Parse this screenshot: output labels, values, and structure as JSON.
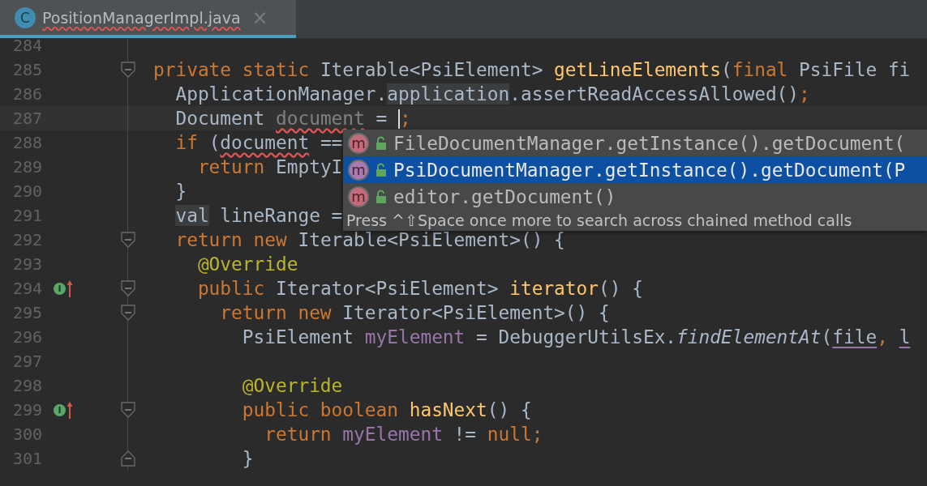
{
  "tab": {
    "icon_letter": "C",
    "title": "PositionManagerImpl.java",
    "close": "×",
    "selected": true
  },
  "lines": [
    {
      "number": "284"
    },
    {
      "number": "285",
      "fold": {
        "kind": "start"
      },
      "tokens": [
        {
          "text": "private static ",
          "kind": "keyword"
        },
        {
          "text": "Iterable<PsiElement> ",
          "kind": "plain"
        },
        {
          "text": "getLineElements",
          "kind": "declaration"
        },
        {
          "text": "(",
          "kind": "plain"
        },
        {
          "text": "final ",
          "kind": "keyword"
        },
        {
          "text": "PsiFile fi",
          "kind": "plain"
        }
      ]
    },
    {
      "number": "286",
      "tokens": [
        {
          "text": "  ApplicationManager.",
          "kind": "plain"
        },
        {
          "text": "application",
          "kind": "highlighted"
        },
        {
          "text": ".assertReadAccessAllowed()",
          "kind": "plain"
        },
        {
          "text": ";",
          "kind": "keyword"
        }
      ]
    },
    {
      "number": "287",
      "current": true,
      "tokens": [
        {
          "text": "  Document ",
          "kind": "plain"
        },
        {
          "text": "document",
          "kind": "unused"
        },
        {
          "text": " = ",
          "kind": "plain"
        },
        {
          "kind": "caret"
        },
        {
          "text": ";",
          "kind": "keyword"
        }
      ]
    },
    {
      "number": "288",
      "tokens": [
        {
          "text": "  if ",
          "kind": "keyword"
        },
        {
          "text": "(",
          "kind": "plain"
        },
        {
          "text": "document",
          "kind": "typo"
        },
        {
          "text": " ==",
          "kind": "plain"
        }
      ]
    },
    {
      "number": "289",
      "tokens": [
        {
          "text": "    return ",
          "kind": "keyword"
        },
        {
          "text": "EmptyI",
          "kind": "plain"
        }
      ]
    },
    {
      "number": "290",
      "tokens": [
        {
          "text": "  }",
          "kind": "plain"
        }
      ]
    },
    {
      "number": "291",
      "tokens": [
        {
          "text": "  val",
          "kind": "highlighted"
        },
        {
          "text": " lineRange =",
          "kind": "plain"
        }
      ]
    },
    {
      "number": "292",
      "fold": {
        "kind": "start"
      },
      "tokens": [
        {
          "text": "  return new ",
          "kind": "keyword"
        },
        {
          "text": "Iterable<PsiElement>() {",
          "kind": "plain"
        }
      ]
    },
    {
      "number": "293",
      "tokens": [
        {
          "text": "    @Override",
          "kind": "annotation"
        }
      ]
    },
    {
      "number": "294",
      "fold": {
        "kind": "start"
      },
      "marker": {
        "kind": "implements",
        "letter": "I"
      },
      "tokens": [
        {
          "text": "    public ",
          "kind": "keyword"
        },
        {
          "text": "Iterator<PsiElement> ",
          "kind": "plain"
        },
        {
          "text": "iterator",
          "kind": "declaration"
        },
        {
          "text": "() {",
          "kind": "plain"
        }
      ]
    },
    {
      "number": "295",
      "fold": {
        "kind": "start"
      },
      "tokens": [
        {
          "text": "      return new ",
          "kind": "keyword"
        },
        {
          "text": "Iterator<PsiElement>() {",
          "kind": "plain"
        }
      ]
    },
    {
      "number": "296",
      "tokens": [
        {
          "text": "        PsiElement ",
          "kind": "plain"
        },
        {
          "text": "myElement",
          "kind": "field"
        },
        {
          "text": " = DebuggerUtilsEx.",
          "kind": "plain"
        },
        {
          "text": "findElementAt",
          "kind": "static"
        },
        {
          "text": "(",
          "kind": "plain"
        },
        {
          "text": "file",
          "kind": "underlined"
        },
        {
          "text": ", ",
          "kind": "keyword"
        },
        {
          "text": "l",
          "kind": "underlined"
        }
      ]
    },
    {
      "number": "297"
    },
    {
      "number": "298",
      "tokens": [
        {
          "text": "        @Override",
          "kind": "annotation"
        }
      ]
    },
    {
      "number": "299",
      "fold": {
        "kind": "start"
      },
      "marker": {
        "kind": "implements",
        "letter": "I"
      },
      "tokens": [
        {
          "text": "        public boolean ",
          "kind": "keyword"
        },
        {
          "text": "hasNext",
          "kind": "declaration"
        },
        {
          "text": "() {",
          "kind": "plain"
        }
      ]
    },
    {
      "number": "300",
      "tokens": [
        {
          "text": "          return ",
          "kind": "keyword"
        },
        {
          "text": "myElement",
          "kind": "field"
        },
        {
          "text": " != ",
          "kind": "plain"
        },
        {
          "text": "null;",
          "kind": "keyword"
        }
      ]
    },
    {
      "number": "301",
      "fold": {
        "kind": "end"
      },
      "tokens": [
        {
          "text": "        }",
          "kind": "plain"
        }
      ]
    }
  ],
  "completion": {
    "items": [
      {
        "icon_letter": "m",
        "text": "FileDocumentManager.getInstance().getDocument(",
        "selected": false
      },
      {
        "icon_letter": "m",
        "text": "PsiDocumentManager.getInstance().getDocument(P",
        "selected": true
      },
      {
        "icon_letter": "m",
        "text": "editor.getDocument()",
        "selected": false
      }
    ],
    "hint": "Press ^⇧Space once more to search across chained method calls"
  }
}
